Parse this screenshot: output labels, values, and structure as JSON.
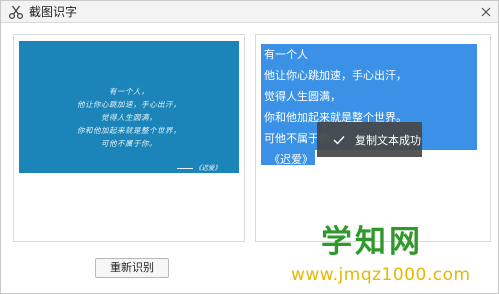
{
  "window": {
    "title": "截图识字",
    "icon": "scissors-icon",
    "close_icon": "close-icon"
  },
  "source_image": {
    "lines": [
      "有一个人，",
      "他让你心跳加速，手心出汗，",
      "觉得人生圆满，",
      "你和他加起来就是整个世界，",
      "可他不属于你。"
    ],
    "signature": "《迟爱》"
  },
  "result": {
    "lines": [
      "有一个人",
      "他让你心跳加速，手心出汗，",
      "觉得人生圆满，",
      "你和他加起来就是整个世界。",
      "可他不属于你。",
      "《迟爱》"
    ],
    "selection_color": "#3b91e6"
  },
  "toast": {
    "icon": "check-icon",
    "text": "复制文本成功"
  },
  "buttons": {
    "recognize_again": "重新识别"
  },
  "watermark": {
    "title": "学知网",
    "url": "www.jmqz1000.com"
  },
  "colors": {
    "image_bg": "#1b84b8",
    "watermark_green": "#2f9a2b",
    "watermark_yellow": "#e6b800"
  }
}
